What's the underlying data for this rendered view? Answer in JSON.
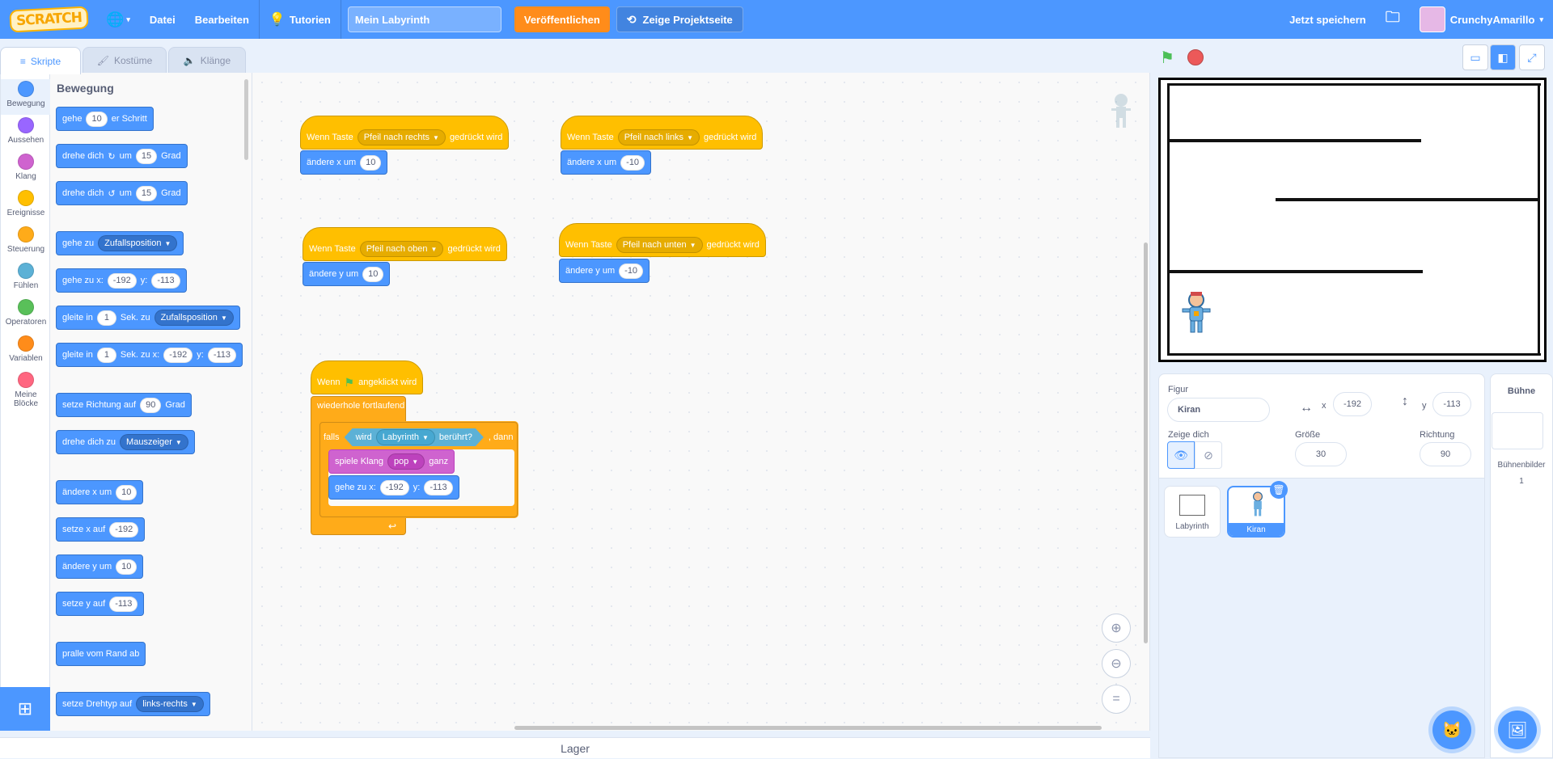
{
  "menubar": {
    "logo": "SCRATCH",
    "file": "Datei",
    "edit": "Bearbeiten",
    "tutorials": "Tutorien",
    "project_title": "Mein Labyrinth",
    "share": "Veröffentlichen",
    "see_project": "Zeige Projektseite",
    "save_now": "Jetzt speichern",
    "username": "CrunchyAmarillo"
  },
  "tabs": {
    "code": "Skripte",
    "costumes": "Kostüme",
    "sounds": "Klänge"
  },
  "categories": [
    {
      "label": "Bewegung",
      "color": "#4c97ff"
    },
    {
      "label": "Aussehen",
      "color": "#9966ff"
    },
    {
      "label": "Klang",
      "color": "#cf63cf"
    },
    {
      "label": "Ereignisse",
      "color": "#ffbf00"
    },
    {
      "label": "Steuerung",
      "color": "#ffab19"
    },
    {
      "label": "Fühlen",
      "color": "#5cb1d6"
    },
    {
      "label": "Operatoren",
      "color": "#59c059"
    },
    {
      "label": "Variablen",
      "color": "#ff8c1a"
    },
    {
      "label": "Meine Blöcke",
      "color": "#ff6680"
    }
  ],
  "palette": {
    "heading": "Bewegung",
    "move": {
      "a": "gehe",
      "n": "10",
      "b": "er Schritt"
    },
    "turn_right": {
      "a": "drehe dich",
      "b": "um",
      "n": "15",
      "c": "Grad"
    },
    "turn_left": {
      "a": "drehe dich",
      "b": "um",
      "n": "15",
      "c": "Grad"
    },
    "goto": {
      "a": "gehe zu",
      "dd": "Zufallsposition"
    },
    "goto_xy": {
      "a": "gehe zu x:",
      "x": "-192",
      "b": "y:",
      "y": "-113"
    },
    "glide": {
      "a": "gleite in",
      "n": "1",
      "b": "Sek. zu",
      "dd": "Zufallsposition"
    },
    "glide_xy": {
      "a": "gleite in",
      "n": "1",
      "b": "Sek. zu x:",
      "x": "-192",
      "c": "y:",
      "y": "-113"
    },
    "point_dir": {
      "a": "setze Richtung auf",
      "n": "90",
      "b": "Grad"
    },
    "point_towards": {
      "a": "drehe dich zu",
      "dd": "Mauszeiger"
    },
    "change_x": {
      "a": "ändere x um",
      "n": "10"
    },
    "set_x": {
      "a": "setze x auf",
      "n": "-192"
    },
    "change_y": {
      "a": "ändere y um",
      "n": "10"
    },
    "set_y": {
      "a": "setze y auf",
      "n": "-113"
    },
    "bounce": {
      "a": "pralle vom Rand ab"
    },
    "rot_style": {
      "a": "setze Drehtyp auf",
      "dd": "links-rechts"
    }
  },
  "scripts": {
    "s1": {
      "a": "Wenn Taste",
      "dd": "Pfeil nach rechts",
      "b": "gedrückt wird",
      "c": "ändere x um",
      "n": "10"
    },
    "s2": {
      "a": "Wenn Taste",
      "dd": "Pfeil nach links",
      "b": "gedrückt wird",
      "c": "ändere x um",
      "n": "-10"
    },
    "s3": {
      "a": "Wenn Taste",
      "dd": "Pfeil nach oben",
      "b": "gedrückt wird",
      "c": "ändere y um",
      "n": "10"
    },
    "s4": {
      "a": "Wenn Taste",
      "dd": "Pfeil nach unten",
      "b": "gedrückt wird",
      "c": "ändere y um",
      "n": "-10"
    },
    "s5": {
      "hat_a": "Wenn",
      "hat_b": "angeklickt wird",
      "forever": "wiederhole fortlaufend",
      "if_a": "falls",
      "touch_a": "wird",
      "touch_dd": "Labyrinth",
      "touch_b": "berührt?",
      "if_b": ", dann",
      "sound_a": "spiele Klang",
      "sound_dd": "pop",
      "sound_b": "ganz",
      "goto_a": "gehe zu x:",
      "x": "-192",
      "goto_b": "y:",
      "y": "-113"
    }
  },
  "workspace": {
    "storage": "Lager"
  },
  "sprite": {
    "label_sprite": "Figur",
    "name": "Kiran",
    "x_label": "x",
    "x": "-192",
    "y_label": "y",
    "y": "-113",
    "show_label": "Zeige dich",
    "size_label": "Größe",
    "size": "30",
    "dir_label": "Richtung",
    "dir": "90"
  },
  "sprites": [
    {
      "name": "Labyrinth"
    },
    {
      "name": "Kiran"
    }
  ],
  "stage_pane": {
    "title": "Bühne",
    "backdrops_label": "Bühnenbilder",
    "backdrops_count": "1"
  },
  "colors": {
    "motion": "#4c97ff",
    "events": "#ffbf00",
    "control": "#ffab19",
    "sound": "#cf63cf",
    "sensing": "#5cb1d6",
    "menubar": "#4c97ff"
  }
}
